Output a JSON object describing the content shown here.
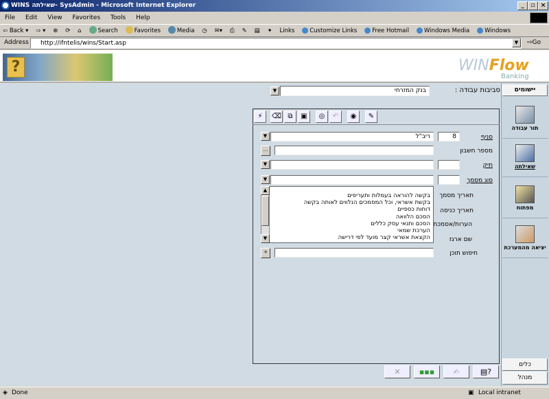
{
  "window": {
    "title": "WINS שאילתה- SysAdmin - Microsoft Internet Explorer"
  },
  "menu": [
    "File",
    "Edit",
    "View",
    "Favorites",
    "Tools",
    "Help"
  ],
  "toolbar": {
    "back": "Back",
    "search": "Search",
    "favorites": "Favorites",
    "media": "Media",
    "links": "Links",
    "link_items": [
      "Customize Links",
      "Free Hotmail",
      "Windows Media",
      "Windows"
    ]
  },
  "address": {
    "label": "Address",
    "url": "http://ifntelis/wins/Start.asp",
    "go": "Go"
  },
  "banner": {
    "brand_win": "WIN",
    "brand_flow": "Flow",
    "brand_sub": "Banking"
  },
  "env": {
    "label": "סביבות עבודה :",
    "value": "בנק המזרחי"
  },
  "sidebar": {
    "top_button": "יישומים",
    "items": [
      {
        "label": "תור עבודה"
      },
      {
        "label": "שאילתה"
      },
      {
        "label": "מפתוח"
      },
      {
        "label": "יציאה מהמערכת"
      }
    ],
    "tools_button": "כלים",
    "admin_button": "מנהל"
  },
  "form": {
    "branch_label": "סניף",
    "branch_number": "8",
    "branch_name": "ריב\"ל",
    "account_label": "מספר חשבון",
    "folder_label": "תיק",
    "doctype_label": "סוג מסמך",
    "docdate_label": "תאריך מסמך",
    "entrydate_label": "תאריך כניסה",
    "notes_label": "הערות/אסמכתא",
    "organizer_label": "שם ארגז",
    "search_label": "חיפוש תוכן",
    "list_items": [
      "בקשה להוראה בעמלות ותעריפים",
      "בקשת אשראי, וכל המסמכים הנלווים לאותה בקשה",
      "דוחות כספיים",
      "הסכם הלוואה",
      "הסכם ותנאי עסק כללים",
      "הערכת שמאי",
      "הקצאת אשראי קצר מועד לפי דרישה"
    ],
    "lookup_button": "...",
    "plus_button": "+"
  },
  "status": {
    "left": "Done",
    "right": "Local intranet"
  }
}
